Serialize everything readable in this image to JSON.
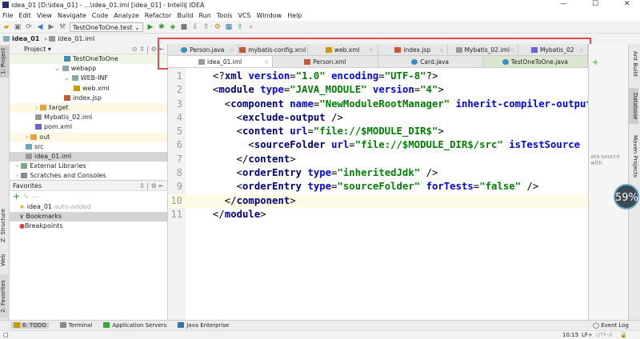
{
  "window": {
    "title": "idea_01 [D:\\idea_01] - ...\\idea_01.iml [idea_01] - IntelliJ IDEA"
  },
  "menu": [
    "File",
    "Edit",
    "View",
    "Navigate",
    "Code",
    "Analyze",
    "Refactor",
    "Build",
    "Run",
    "Tools",
    "VCS",
    "Window",
    "Help"
  ],
  "toolbar": {
    "run_config": "TestOneToOne.test"
  },
  "breadcrumb": [
    "idea_01",
    "idea_01.iml"
  ],
  "left_strip": {
    "project": "1: Project",
    "structure": "Z: Structure",
    "web": "Web",
    "favorites": "2: Favorites"
  },
  "project_panel": {
    "title": "Project",
    "items": [
      {
        "label": "TestOneToOne",
        "indent": 5
      },
      {
        "label": "webapp",
        "indent": 4
      },
      {
        "label": "WEB-INF",
        "indent": 5
      },
      {
        "label": "web.xml",
        "indent": 6
      },
      {
        "label": "index.jsp",
        "indent": 5
      },
      {
        "label": "target",
        "indent": 2
      },
      {
        "label": "Mybatis_02.iml",
        "indent": 2
      },
      {
        "label": "pom.xml",
        "indent": 2
      },
      {
        "label": "out",
        "indent": 1
      },
      {
        "label": "src",
        "indent": 1
      },
      {
        "label": "idea_01.iml",
        "indent": 1
      },
      {
        "label": "External Libraries",
        "indent": 0
      },
      {
        "label": "Scratches and Consoles",
        "indent": 0
      }
    ]
  },
  "favorites": {
    "title": "Favorites",
    "items": [
      {
        "label": "idea_01",
        "note": "auto-added"
      },
      {
        "label": "Bookmarks"
      },
      {
        "label": "Breakpoints"
      }
    ]
  },
  "tabs": {
    "row1": [
      "Person.java",
      "mybatis-config.xml",
      "web.xml",
      "index.jsp",
      "Mybatis_02.iml",
      "Mybatis_02"
    ],
    "row2": [
      "idea_01.iml",
      "Person.xml",
      "Card.java",
      "TestOneToOne.java"
    ],
    "active": "idea_01.iml"
  },
  "editor": {
    "lines": [
      [
        [
          "pu",
          "<?"
        ],
        [
          "tg",
          "xml "
        ],
        [
          "an",
          "version"
        ],
        [
          "pu",
          "="
        ],
        [
          "av",
          "\"1.0\" "
        ],
        [
          "an",
          "encoding"
        ],
        [
          "pu",
          "="
        ],
        [
          "av",
          "\"UTF-8\""
        ],
        [
          "pu",
          "?>"
        ]
      ],
      [
        [
          "pu",
          "<"
        ],
        [
          "tg",
          "module "
        ],
        [
          "an",
          "type"
        ],
        [
          "pu",
          "="
        ],
        [
          "av",
          "\"JAVA_MODULE\" "
        ],
        [
          "an",
          "version"
        ],
        [
          "pu",
          "="
        ],
        [
          "av",
          "\"4\""
        ],
        [
          "pu",
          ">"
        ]
      ],
      [
        [
          "pu",
          "  <"
        ],
        [
          "tg",
          "component "
        ],
        [
          "an",
          "name"
        ],
        [
          "pu",
          "="
        ],
        [
          "av",
          "\"NewModuleRootManager\" "
        ],
        [
          "an",
          "inherit-compiler-output"
        ]
      ],
      [
        [
          "pu",
          "    <"
        ],
        [
          "tg",
          "exclude-output "
        ],
        [
          "pu",
          "/>"
        ]
      ],
      [
        [
          "pu",
          "    <"
        ],
        [
          "tg",
          "content "
        ],
        [
          "an",
          "url"
        ],
        [
          "pu",
          "="
        ],
        [
          "av",
          "\"file://$MODULE_DIR$\""
        ],
        [
          "pu",
          ">"
        ]
      ],
      [
        [
          "pu",
          "      <"
        ],
        [
          "tg",
          "sourceFolder "
        ],
        [
          "an",
          "url"
        ],
        [
          "pu",
          "="
        ],
        [
          "av",
          "\"file://$MODULE_DIR$/src\" "
        ],
        [
          "an",
          "isTestSource"
        ]
      ],
      [
        [
          "pu",
          "    </"
        ],
        [
          "tg",
          "content"
        ],
        [
          "pu",
          ">"
        ]
      ],
      [
        [
          "pu",
          "    <"
        ],
        [
          "tg",
          "orderEntry "
        ],
        [
          "an",
          "type"
        ],
        [
          "pu",
          "="
        ],
        [
          "av",
          "\"inheritedJdk\" "
        ],
        [
          "pu",
          "/>"
        ]
      ],
      [
        [
          "pu",
          "    <"
        ],
        [
          "tg",
          "orderEntry "
        ],
        [
          "an",
          "type"
        ],
        [
          "pu",
          "="
        ],
        [
          "av",
          "\"sourceFolder\" "
        ],
        [
          "an",
          "forTests"
        ],
        [
          "pu",
          "="
        ],
        [
          "av",
          "\"false\" "
        ],
        [
          "pu",
          "/>"
        ]
      ],
      [
        [
          "pu",
          "  </"
        ],
        [
          "tg",
          "component"
        ],
        [
          "pu",
          ">"
        ]
      ],
      [
        [
          "pu",
          "</"
        ],
        [
          "tg",
          "module"
        ],
        [
          "pu",
          ">"
        ]
      ]
    ],
    "line_numbers": [
      "1",
      "2",
      "3",
      "4",
      "5",
      "6",
      "7",
      "8",
      "9",
      "10",
      "11"
    ]
  },
  "right_strip": {
    "ant": "Ant Build",
    "database": "Database",
    "maven": "Maven Projects",
    "hint": "ata source with"
  },
  "badge": "59%",
  "bottom_tools": [
    "6: TODO",
    "Terminal",
    "Application Servers",
    "Java Enterprise"
  ],
  "event_log": "Event Log",
  "status": {
    "pos": "10:15",
    "sep": "LF÷",
    "enc": "UTF-8"
  }
}
